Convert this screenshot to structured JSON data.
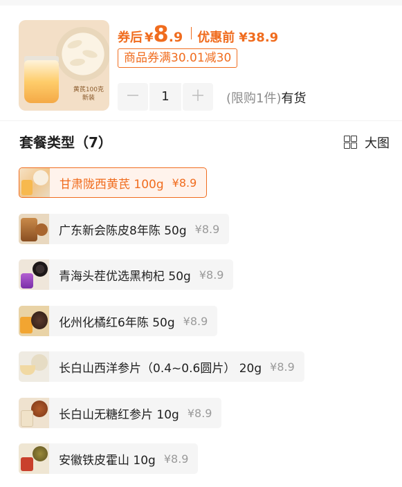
{
  "header": {
    "thumb_caption": "黄芪100克",
    "thumb_caption2": "新装",
    "after_coupon_label": "券后",
    "yen": "¥",
    "price_int": "8",
    "price_dec": ".9",
    "before_label": "优惠前",
    "original_price": "¥38.9",
    "coupon_text": "商品券满30.01减30"
  },
  "stepper": {
    "minus": "－",
    "quantity": "1",
    "plus": "＋",
    "limit_text": "(限购1件)",
    "stock_text": "有货"
  },
  "section": {
    "title": "套餐类型（7）",
    "view_toggle": "大图"
  },
  "options": [
    {
      "name": "甘肃陇西黄芪  100g",
      "price": "¥8.9",
      "selected": true,
      "thumb": "astragalus-thumb"
    },
    {
      "name": "广东新会陈皮8年陈 50g",
      "price": "¥8.9",
      "selected": false,
      "thumb": "tangerine-peel-thumb"
    },
    {
      "name": "青海头茬优选黑枸杞 50g",
      "price": "¥8.9",
      "selected": false,
      "thumb": "black-goji-thumb"
    },
    {
      "name": "化州化橘红6年陈 50g",
      "price": "¥8.9",
      "selected": false,
      "thumb": "huajuhong-thumb"
    },
    {
      "name": "长白山西洋参片（0.4~0.6圆片） 20g",
      "price": "¥8.9",
      "selected": false,
      "thumb": "american-ginseng-thumb"
    },
    {
      "name": "长白山无糖红参片 10g",
      "price": "¥8.9",
      "selected": false,
      "thumb": "red-ginseng-thumb"
    },
    {
      "name": "安徽铁皮霍山 10g",
      "price": "¥8.9",
      "selected": false,
      "thumb": "dendrobium-thumb"
    }
  ],
  "colors": {
    "accent": "#f06c1e",
    "option_bg": "#f5f5f5",
    "selected_bg": "#fff3ec",
    "price_grey": "#9a9a9a"
  }
}
